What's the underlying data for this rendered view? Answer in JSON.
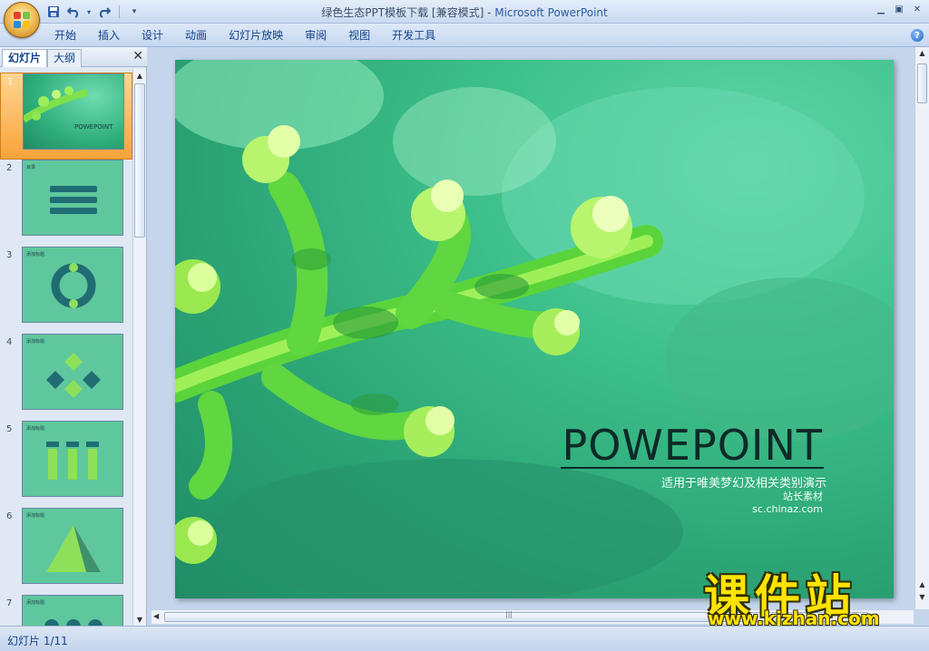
{
  "window": {
    "doc_title": "绿色生态PPT模板下载 [兼容模式]",
    "separator": " - ",
    "app_name": "Microsoft PowerPoint"
  },
  "qat": {
    "save_icon": "save-icon",
    "undo_icon": "undo-icon",
    "redo_icon": "redo-icon",
    "customize_icon": "customize-icon"
  },
  "ribbon": {
    "tabs": [
      "开始",
      "插入",
      "设计",
      "动画",
      "幻灯片放映",
      "审阅",
      "视图",
      "开发工具"
    ],
    "help_label": "?"
  },
  "left_panel": {
    "tab_slides": "幻灯片",
    "tab_outline": "大纲",
    "close_label": "✕",
    "thumbnails": [
      {
        "num": "1",
        "cover_text": "POWEPOINT"
      },
      {
        "num": "2",
        "title": "目录"
      },
      {
        "num": "3",
        "title": "添加标题"
      },
      {
        "num": "4",
        "title": "添加标题"
      },
      {
        "num": "5",
        "title": "添加标题"
      },
      {
        "num": "6",
        "title": "添加标题"
      },
      {
        "num": "7",
        "title": "添加标题"
      }
    ]
  },
  "slide": {
    "title": "POWEPOINT",
    "subtitle": "适用于唯美梦幻及相关类别演示",
    "author": "站长素材",
    "url": "sc.chinaz.com"
  },
  "watermark": {
    "cn": "课件站",
    "en": "www.kjzhan.com"
  },
  "status": {
    "slide_indicator": "幻灯片 1/11"
  },
  "colors": {
    "accent": "#15428b",
    "slide_bg": "#3cbf8a",
    "selected_thumb": "#f7a33a",
    "watermark": "#ffe400"
  }
}
